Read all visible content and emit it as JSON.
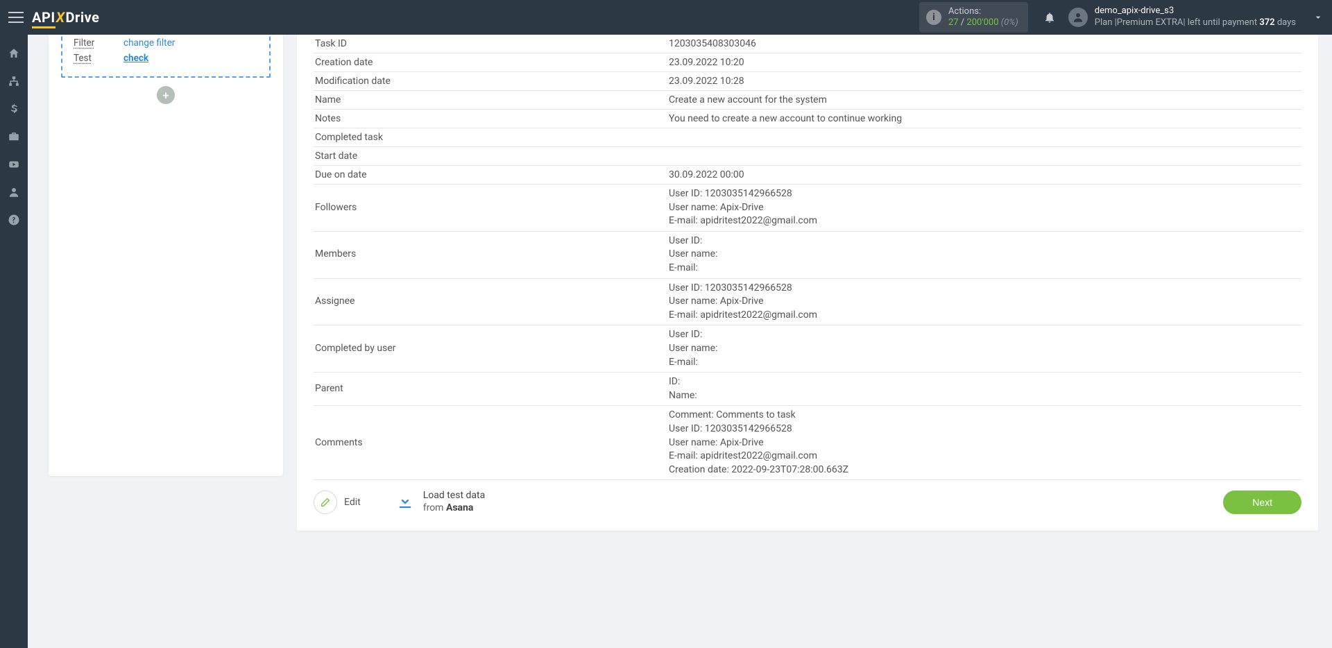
{
  "header": {
    "logo": {
      "api": "API",
      "x": "X",
      "drive": "Drive"
    },
    "actions": {
      "label": "Actions:",
      "used": "27",
      "sep": " / ",
      "max": "200'000",
      "pct": "(0%)"
    },
    "user": {
      "name": "demo_apix-drive_s3",
      "plan_prefix": "Plan |",
      "plan_name": "Premium EXTRA",
      "plan_suffix": "| left until payment ",
      "days": "372",
      "days_unit": " days"
    }
  },
  "left_card": {
    "rows": [
      {
        "label": "Filter",
        "value": "change filter",
        "bold": false
      },
      {
        "label": "Test",
        "value": "check",
        "bold": true
      }
    ],
    "plus": "+"
  },
  "table": [
    {
      "label": "Task ID",
      "value": "1203035408303046"
    },
    {
      "label": "Creation date",
      "value": "23.09.2022 10:20"
    },
    {
      "label": "Modification date",
      "value": "23.09.2022 10:28"
    },
    {
      "label": "Name",
      "value": "Create a new account for the system"
    },
    {
      "label": "Notes",
      "value": "You need to create a new account to continue working"
    },
    {
      "label": "Completed task",
      "value": ""
    },
    {
      "label": "Start date",
      "value": ""
    },
    {
      "label": "Due on date",
      "value": "30.09.2022 00:00"
    },
    {
      "label": "Followers",
      "lines": [
        "User ID: 1203035142966528",
        "User name: Apix-Drive",
        "E-mail: apidritest2022@gmail.com"
      ]
    },
    {
      "label": "Members",
      "lines": [
        "User ID:",
        "User name:",
        "E-mail:"
      ]
    },
    {
      "label": "Assignee",
      "lines": [
        "User ID: 1203035142966528",
        "User name: Apix-Drive",
        "E-mail: apidritest2022@gmail.com"
      ]
    },
    {
      "label": "Completed by user",
      "lines": [
        "User ID:",
        "User name:",
        "E-mail:"
      ]
    },
    {
      "label": "Parent",
      "lines": [
        "ID:",
        "Name:"
      ]
    },
    {
      "label": "Comments",
      "lines": [
        "Comment: Comments to task",
        "User ID: 1203035142966528",
        "User name: Apix-Drive",
        "E-mail: apidritest2022@gmail.com",
        "Creation date: 2022-09-23T07:28:00.663Z"
      ]
    }
  ],
  "footer": {
    "edit": "Edit",
    "load_line1": "Load test data",
    "load_line2_prefix": "from ",
    "load_line2_brand": "Asana",
    "next": "Next"
  }
}
